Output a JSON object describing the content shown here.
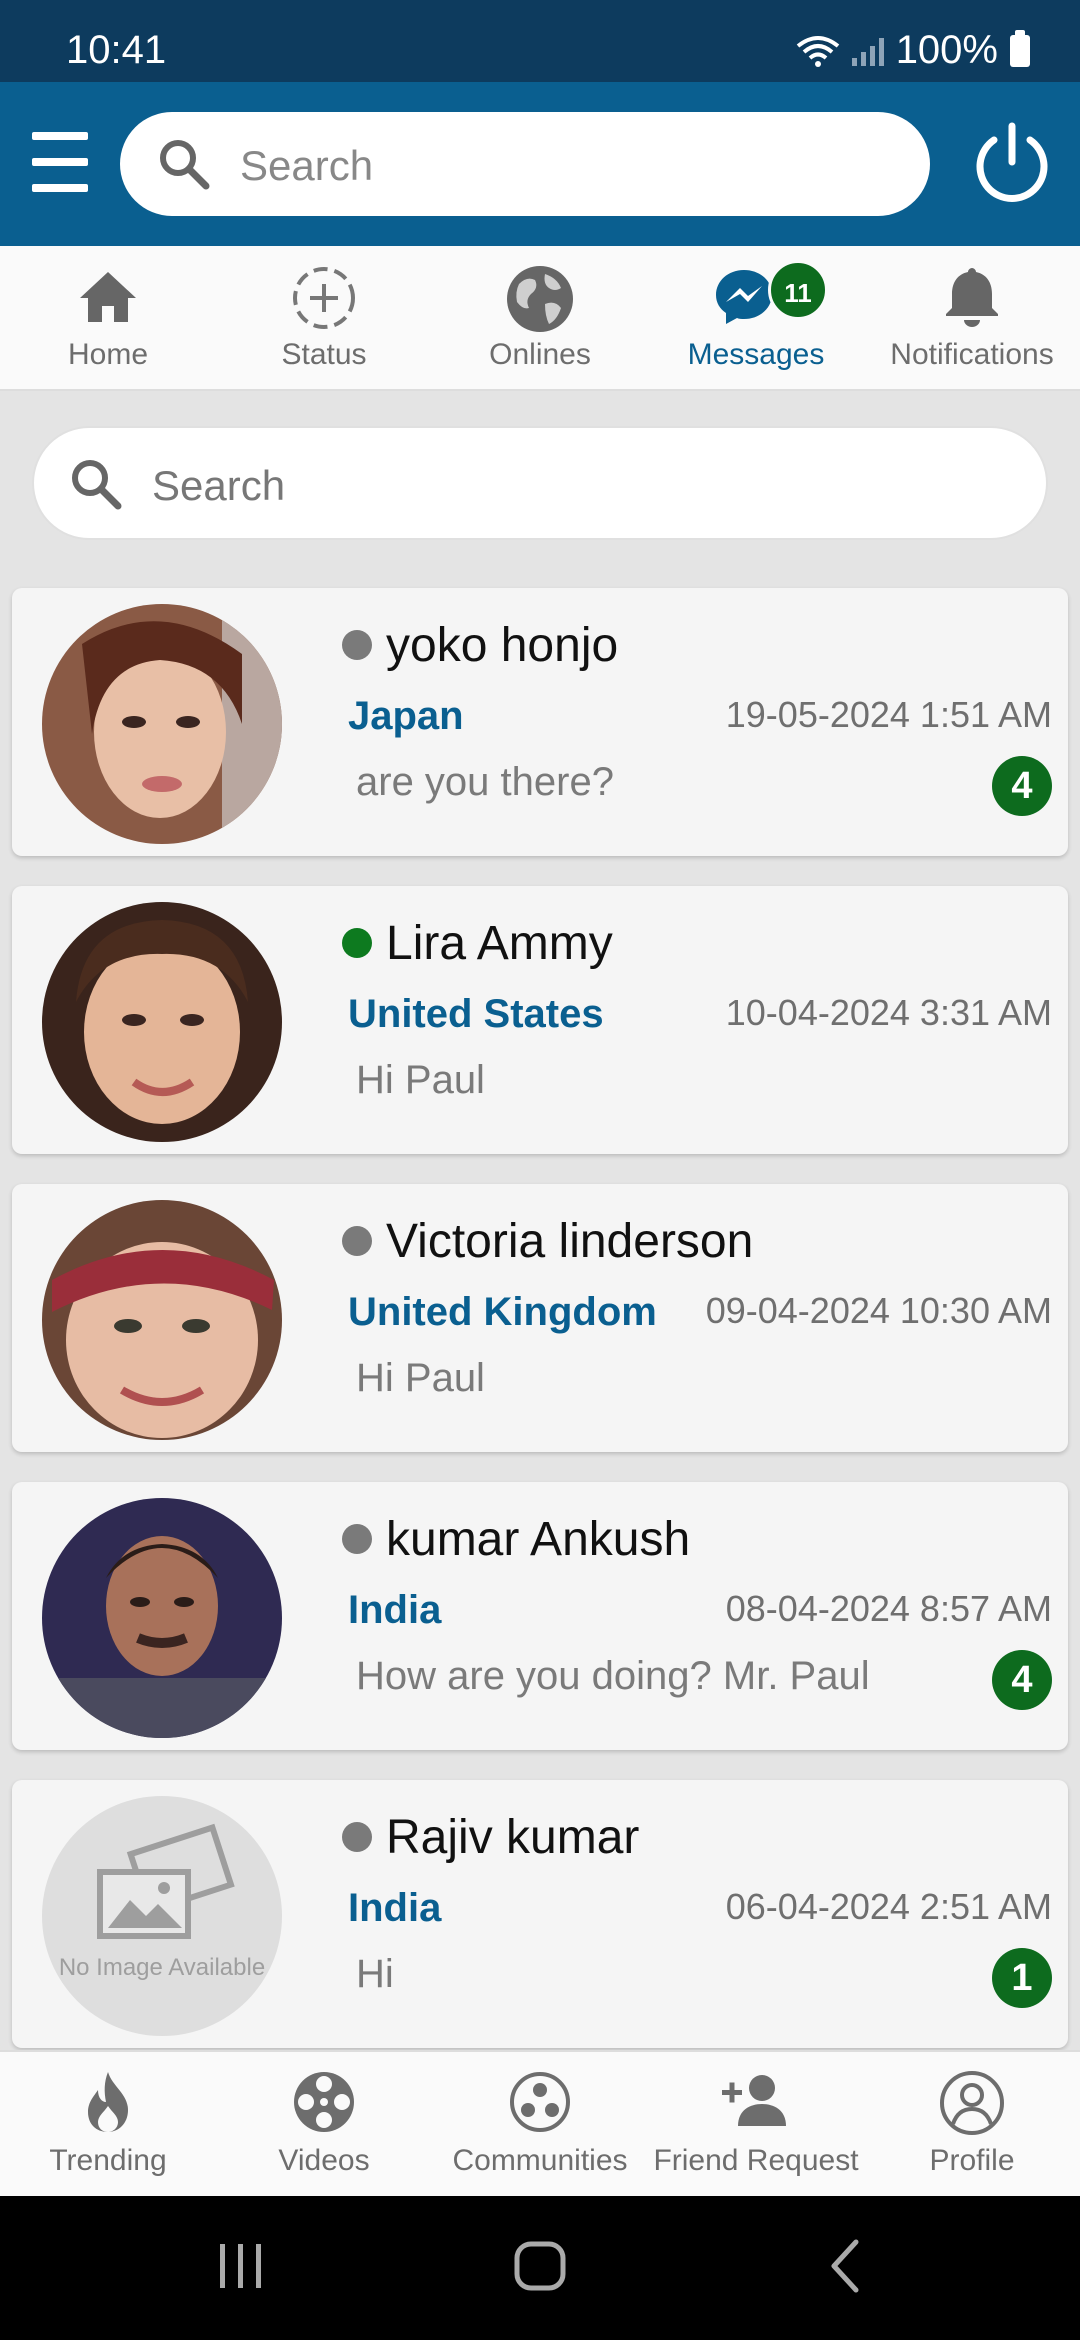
{
  "status_bar": {
    "time": "10:41",
    "battery": "100%"
  },
  "header": {
    "search_placeholder": "Search"
  },
  "nav_tabs": [
    {
      "label": "Home",
      "icon": "home-icon"
    },
    {
      "label": "Status",
      "icon": "add-status-icon"
    },
    {
      "label": "Onlines",
      "icon": "globe-icon"
    },
    {
      "label": "Messages",
      "icon": "messenger-icon",
      "badge": "11",
      "active": true
    },
    {
      "label": "Notifications",
      "icon": "bell-icon"
    }
  ],
  "list_search": {
    "placeholder": "Search"
  },
  "chats": [
    {
      "name": "yoko honjo",
      "online": false,
      "country": "Japan",
      "date": "19-05-2024 1:51 AM",
      "message": "are you there?",
      "unread": "4"
    },
    {
      "name": "Lira Ammy",
      "online": true,
      "country": "United States",
      "date": "10-04-2024 3:31 AM",
      "message": "Hi Paul",
      "unread": ""
    },
    {
      "name": "Victoria linderson",
      "online": false,
      "country": "United Kingdom",
      "date": "09-04-2024 10:30 AM",
      "message": "Hi Paul",
      "unread": ""
    },
    {
      "name": "kumar Ankush",
      "online": false,
      "country": "India",
      "date": "08-04-2024 8:57 AM",
      "message": "How are you doing? Mr. Paul",
      "unread": "4"
    },
    {
      "name": "Rajiv kumar",
      "online": false,
      "country": "India",
      "date": "06-04-2024 2:51 AM",
      "message": "Hi",
      "unread": "1",
      "no_image_text": "No Image Available"
    }
  ],
  "bottom_tabs": [
    {
      "label": "Trending",
      "icon": "flame-icon"
    },
    {
      "label": "Videos",
      "icon": "film-reel-icon"
    },
    {
      "label": "Communities",
      "icon": "communities-icon"
    },
    {
      "label": "Friend Request",
      "icon": "add-person-icon"
    },
    {
      "label": "Profile",
      "icon": "profile-icon"
    }
  ],
  "colors": {
    "primary": "#0a5f90",
    "status_bar": "#0d3b5e",
    "badge": "#0d6b1e",
    "online": "#0d7a1f"
  }
}
